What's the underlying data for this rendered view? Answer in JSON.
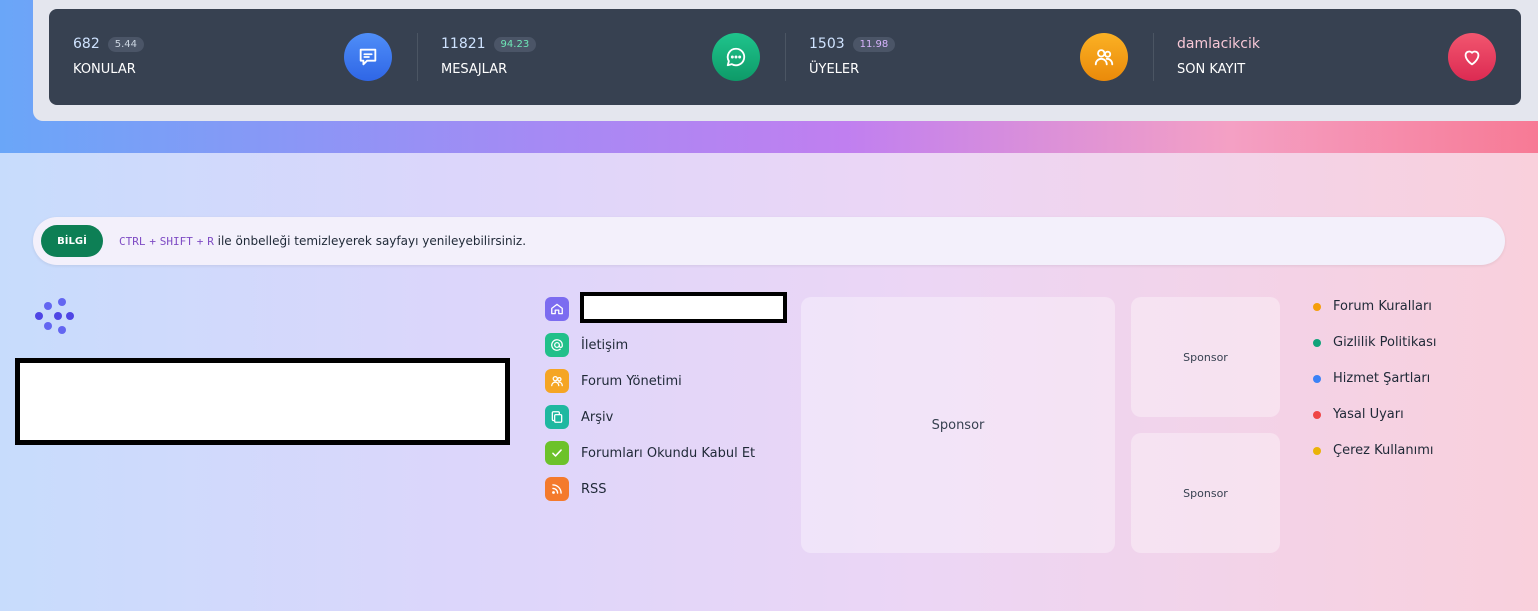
{
  "stats": [
    {
      "value": "682",
      "badge": "5.44",
      "label": "KONULAR",
      "icon": "chat-lines-icon",
      "icon_color": "#3b7cf6",
      "badge_color": "#cbd5e1"
    },
    {
      "value": "11821",
      "badge": "94.23",
      "label": "MESAJLAR",
      "icon": "chat-bubble-icon",
      "icon_color": "#10b07a",
      "badge_color": "#6ee7b7"
    },
    {
      "value": "1503",
      "badge": "11.98",
      "label": "ÜYELER",
      "icon": "users-icon",
      "icon_color": "#f59e0b",
      "badge_color": "#d8b4fe"
    },
    {
      "value": "damlacikcik",
      "label": "SON KAYIT",
      "icon": "heart-icon",
      "icon_color": "#ec4065"
    }
  ],
  "info": {
    "tag": "BİLGİ",
    "key1": "CTRL",
    "plus1": "+",
    "key2": "SHIFT",
    "plus2": "+",
    "key3": "R",
    "message": "ile önbelleği temizleyerek sayfayı yenileyebilirsiniz."
  },
  "nav": [
    {
      "label": "",
      "icon": "home-icon",
      "color": "#7c6cf0"
    },
    {
      "label": "İletişim",
      "icon": "at-icon",
      "color": "#22c08a"
    },
    {
      "label": "Forum Yönetimi",
      "icon": "users-icon",
      "color": "#f5a524"
    },
    {
      "label": "Arşiv",
      "icon": "copy-icon",
      "color": "#1fb8a0"
    },
    {
      "label": "Forumları Okundu Kabul Et",
      "icon": "check-icon",
      "color": "#6cc22a"
    },
    {
      "label": "RSS",
      "icon": "rss-icon",
      "color": "#f47a2c"
    }
  ],
  "sponsors": {
    "big": "Sponsor",
    "small1": "Sponsor",
    "small2": "Sponsor"
  },
  "links": [
    {
      "label": "Forum Kuralları",
      "color": "#f59e0b"
    },
    {
      "label": "Gizlilik Politikası",
      "color": "#10a37a"
    },
    {
      "label": "Hizmet Şartları",
      "color": "#3b82f6"
    },
    {
      "label": "Yasal Uyarı",
      "color": "#ef4444"
    },
    {
      "label": "Çerez Kullanımı",
      "color": "#eab308"
    }
  ]
}
